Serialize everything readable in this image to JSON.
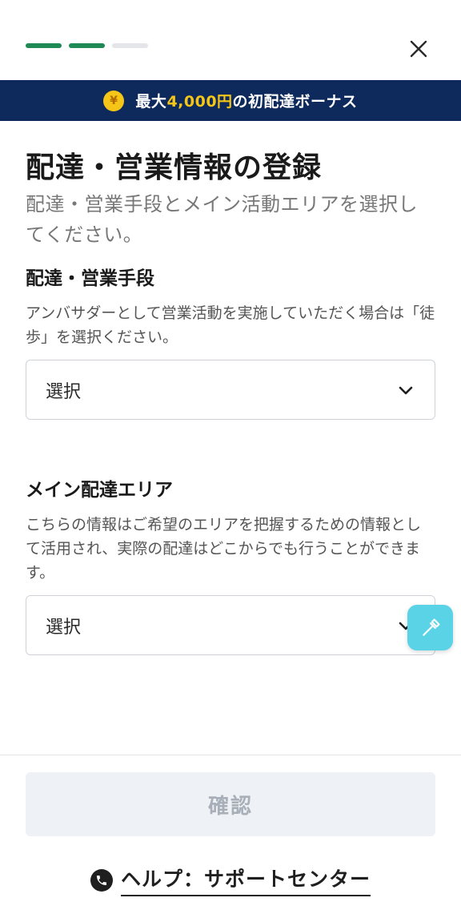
{
  "progress": {
    "total_steps": 3,
    "completed_steps": 2
  },
  "banner": {
    "coin_symbol": "¥",
    "prefix": "最大",
    "amount": "4,000円",
    "suffix": "の初配達ボーナス"
  },
  "page": {
    "title": "配達・営業情報の登録",
    "subtitle": "配達・営業手段とメイン活動エリアを選択してください。"
  },
  "delivery_method": {
    "label": "配達・営業手段",
    "description": "アンバサダーとして営業活動を実施していただく場合は「徒歩」を選択ください。",
    "selected_value": "選択"
  },
  "main_area": {
    "label": "メイン配達エリア",
    "description": "こちらの情報はご希望のエリアを把握するための情報として活用され、実際の配達はどこからでも行うことができます。",
    "selected_value": "選択"
  },
  "footer": {
    "confirm_label": "確認",
    "help_label": "ヘルプ：サポートセンター"
  },
  "colors": {
    "accent_green": "#1f8a55",
    "banner_navy": "#0e2a5c",
    "highlight_yellow": "#f5c518",
    "fab_cyan": "#5ad3e6"
  },
  "icons": {
    "close": "close-icon",
    "chevron": "chevron-down-icon",
    "fab": "eyedropper-icon",
    "help": "phone-icon",
    "coin": "yen-coin-icon"
  }
}
